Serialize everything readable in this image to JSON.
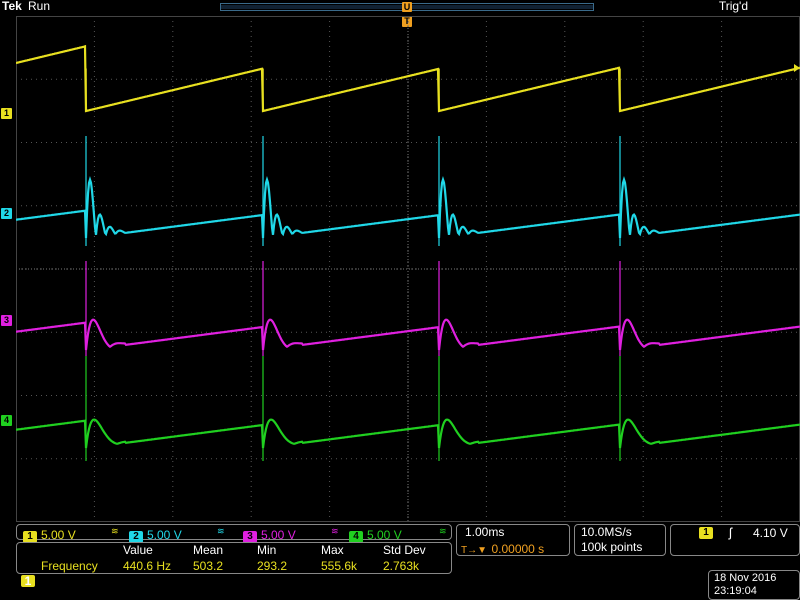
{
  "status": {
    "brand": "Tek",
    "acq_state": "Run",
    "trigger_state": "Trig'd"
  },
  "markers": {
    "trigger_pos_label": "U",
    "trigger_time_label": "T",
    "ch1": "1",
    "ch2": "2",
    "ch3": "3",
    "ch4": "4"
  },
  "colors": {
    "ch1": "#e8e020",
    "ch2": "#20d8e8",
    "ch3": "#e020e0",
    "ch4": "#20d020",
    "trigger": "#f0a020",
    "grid": "#555555"
  },
  "channels": [
    {
      "id": "1",
      "scale": "5.00 V",
      "bw_icon": "bandwidth-icon"
    },
    {
      "id": "2",
      "scale": "5.00 V",
      "bw_icon": "bandwidth-icon"
    },
    {
      "id": "3",
      "scale": "5.00 V",
      "bw_icon": "bandwidth-icon"
    },
    {
      "id": "4",
      "scale": "5.00 V",
      "bw_icon": "bandwidth-icon"
    }
  ],
  "horizontal": {
    "scale": "1.00ms",
    "position": "0.00000 s",
    "position_prefix": "T→▼"
  },
  "acquisition": {
    "sample_rate": "10.0MS/s",
    "record_length": "100k points"
  },
  "trigger": {
    "source": "1",
    "slope_symbol": "ʃ",
    "level": "4.10 V"
  },
  "measurement": {
    "headers": [
      "Value",
      "Mean",
      "Min",
      "Max",
      "Std Dev"
    ],
    "source": "1",
    "name": "Frequency",
    "value": "440.6 Hz",
    "mean": "503.2",
    "min": "293.2",
    "max": "555.6k",
    "std_dev": "2.763k"
  },
  "datetime": {
    "date": "18 Nov 2016",
    "time": "23:19:04"
  }
}
